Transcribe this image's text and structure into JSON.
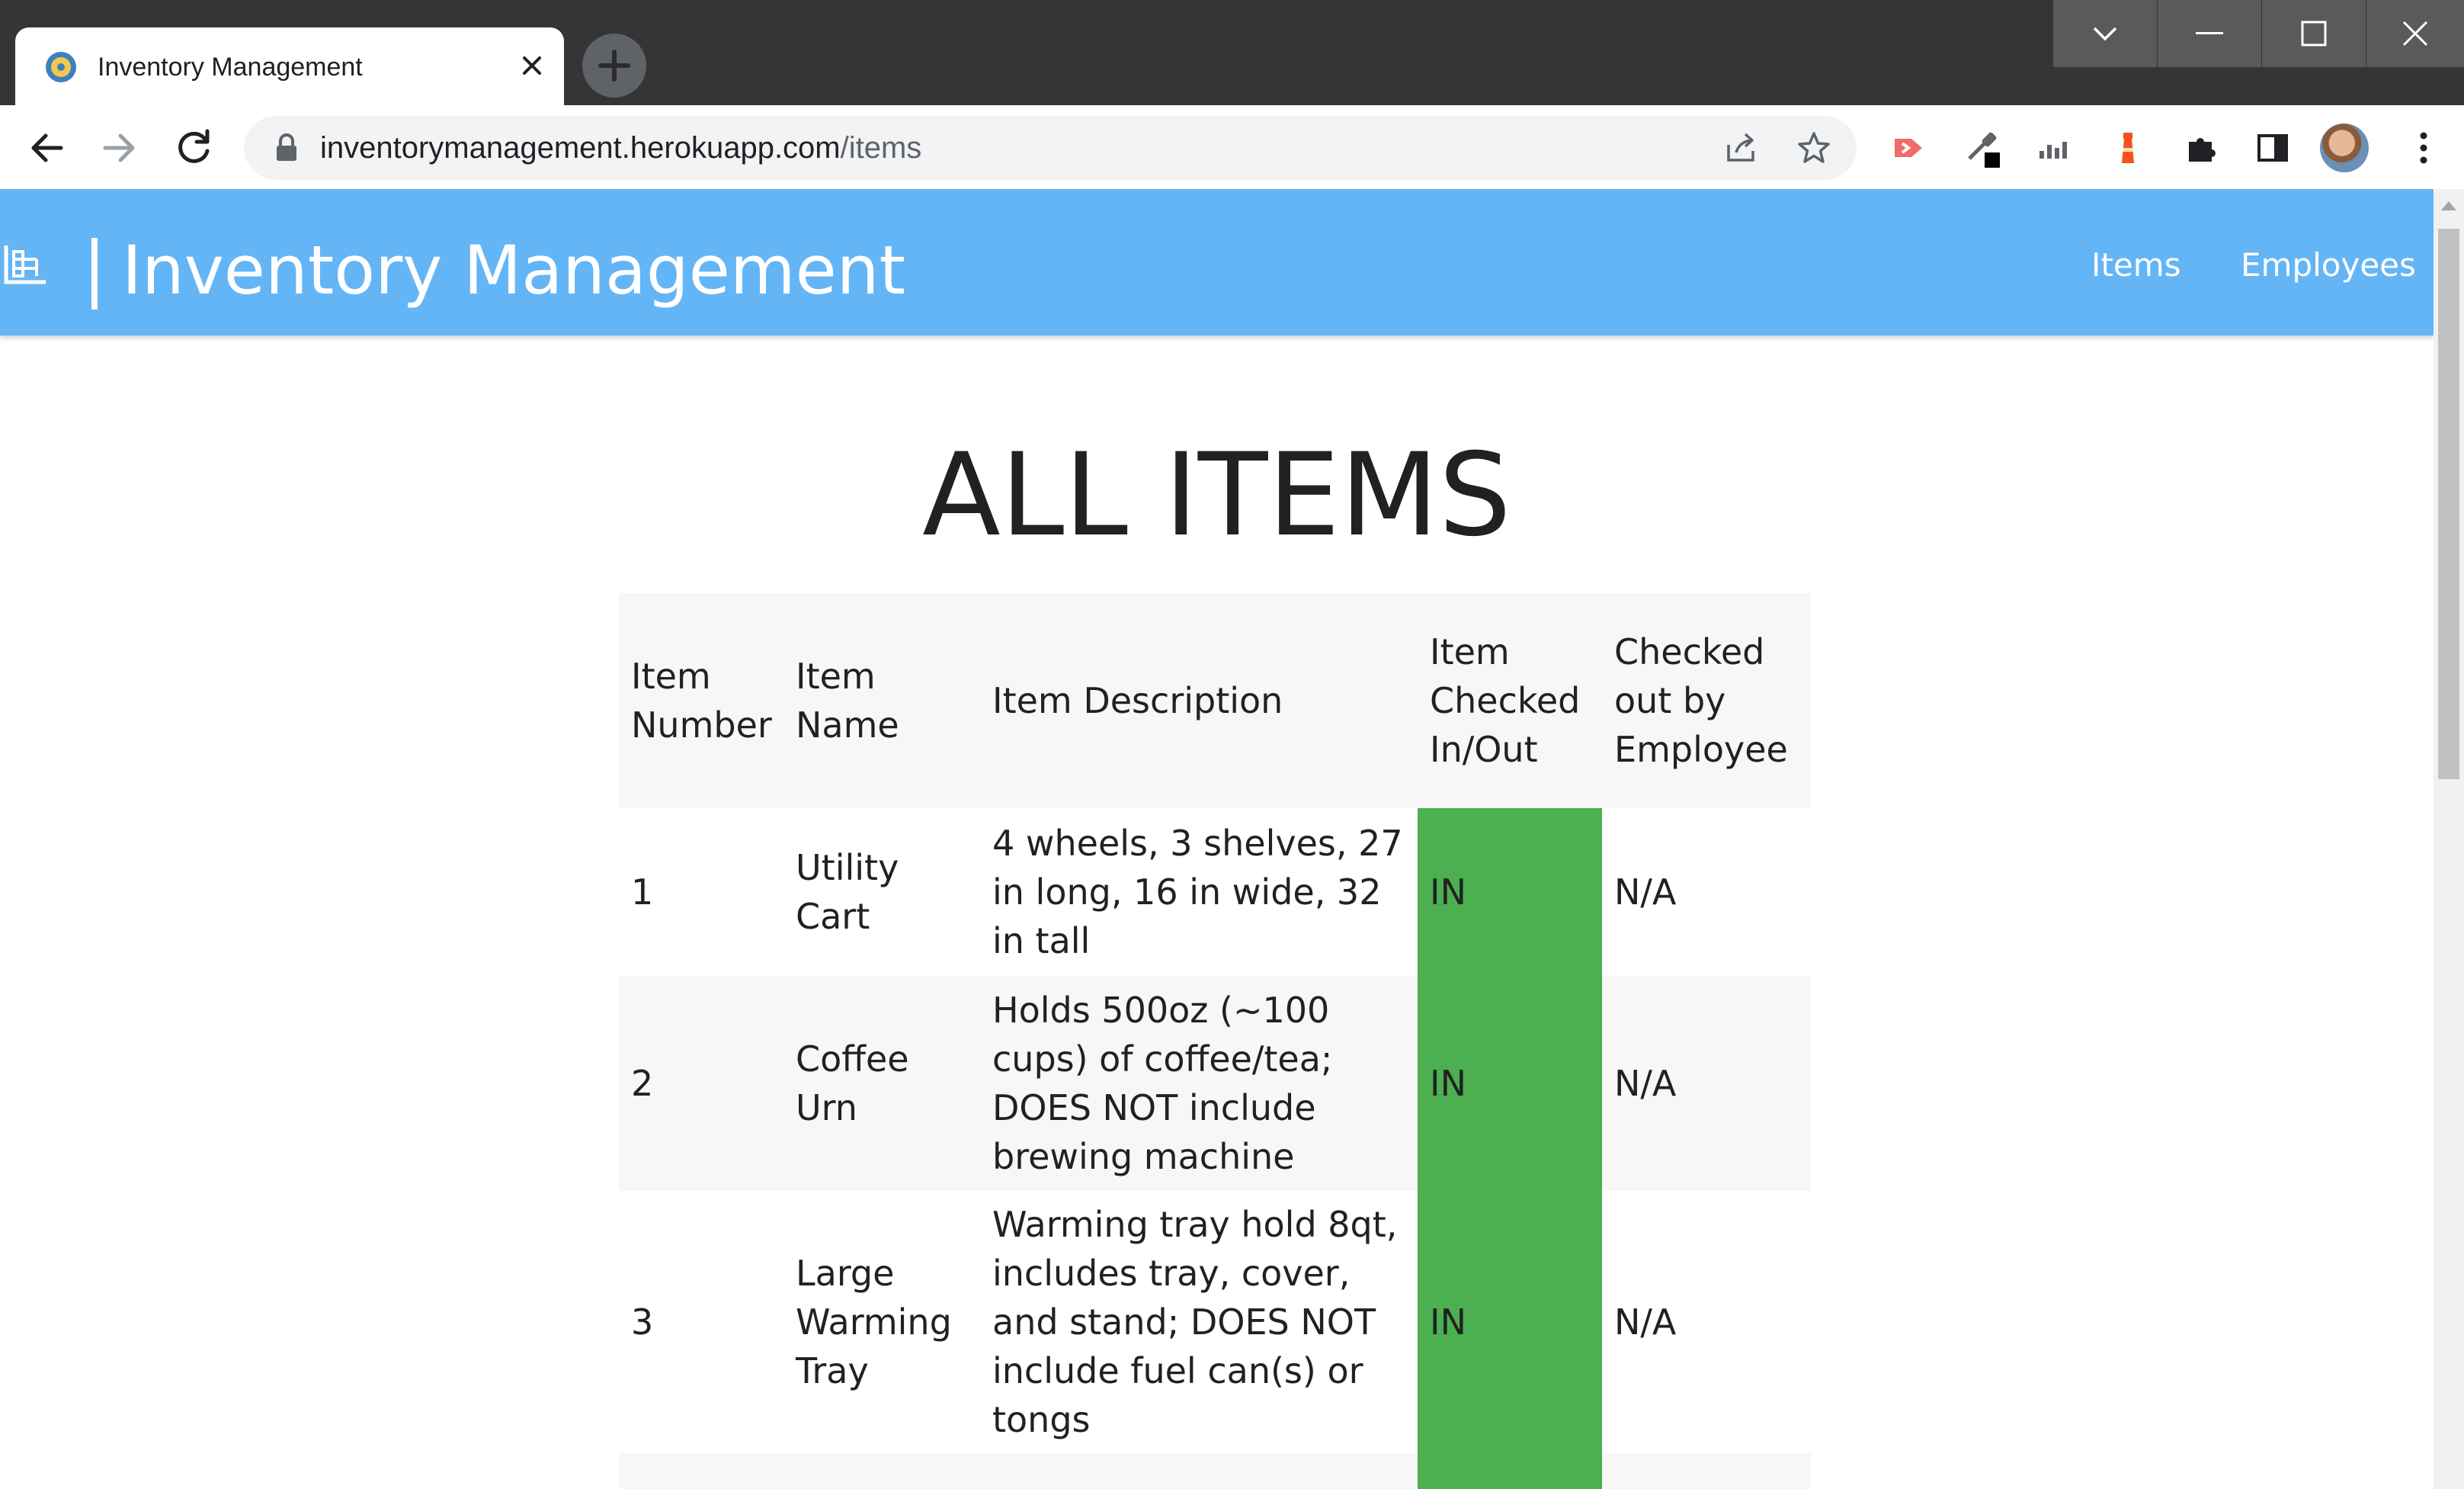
{
  "browser": {
    "tab_title": "Inventory Management",
    "url_host": "inventorymanagement.herokuapp.com",
    "url_path": "/items"
  },
  "navbar": {
    "brand": "| Inventory Management",
    "links": [
      {
        "label": "Items"
      },
      {
        "label": "Employees"
      }
    ]
  },
  "page": {
    "title": "ALL ITEMS"
  },
  "table": {
    "headers": [
      "Item Number",
      "Item Name",
      "Item Description",
      "Item Checked In/Out",
      "Checked out by Employee"
    ],
    "rows": [
      {
        "number": "1",
        "name": "Utility Cart",
        "description": "4 wheels, 3 shelves, 27 in long, 16 in wide, 32 in tall",
        "status": "IN",
        "employee": "N/A"
      },
      {
        "number": "2",
        "name": "Coffee Urn",
        "description": "Holds 500oz (~100 cups) of coffee/tea; DOES NOT include brewing machine",
        "status": "IN",
        "employee": "N/A"
      },
      {
        "number": "3",
        "name": "Large Warming Tray",
        "description": "Warming tray hold 8qt, includes tray, cover, and stand; DOES NOT include fuel can(s) or tongs",
        "status": "IN",
        "employee": "N/A"
      },
      {
        "number": "",
        "name": "",
        "description": "",
        "status": "",
        "employee": ""
      }
    ]
  },
  "colors": {
    "navbar_bg": "#64b5f6",
    "status_in_bg": "#4caf50",
    "titlebar_bg": "#353535"
  }
}
